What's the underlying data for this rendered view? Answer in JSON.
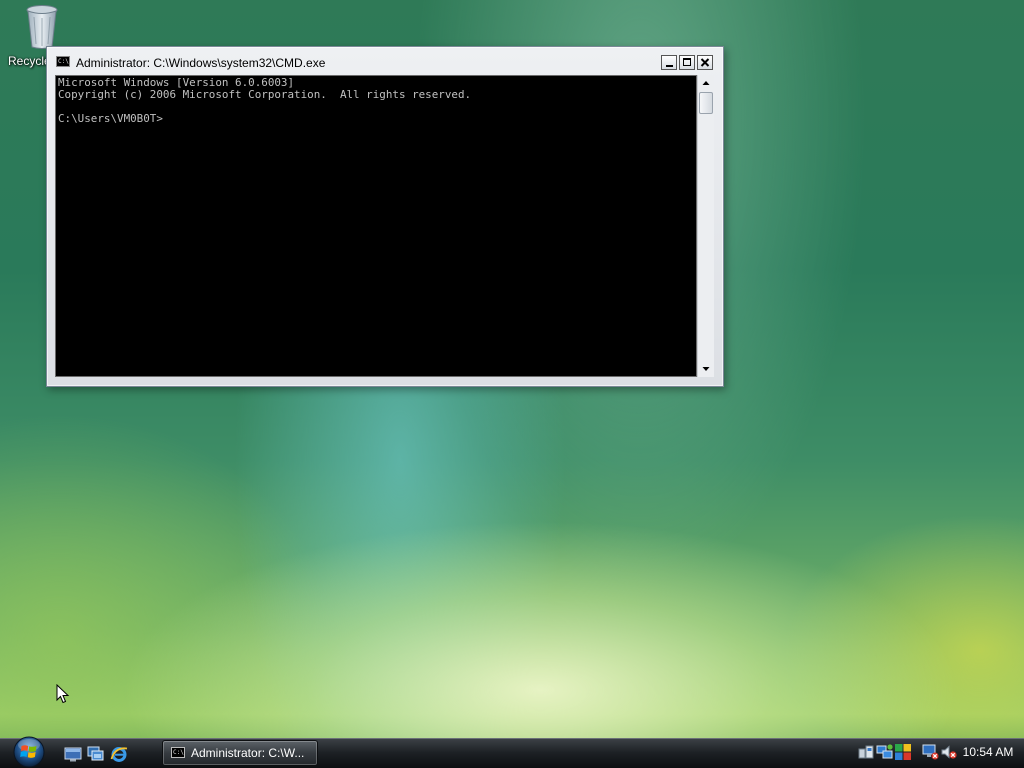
{
  "desktop": {
    "recycle_bin_label": "Recycle"
  },
  "window": {
    "title": "Administrator: C:\\Windows\\system32\\CMD.exe",
    "app_icon_text": "C:\\",
    "console_text": "Microsoft Windows [Version 6.0.6003]\nCopyright (c) 2006 Microsoft Corporation.  All rights reserved.\n\nC:\\Users\\VM0B0T>",
    "background_color": "#000000",
    "text_color": "#c0c0c0"
  },
  "taskbar": {
    "quick_launch": [
      "show-desktop-icon",
      "switch-windows-icon",
      "internet-explorer-icon"
    ],
    "task_button_label": "Administrator: C:\\W...",
    "task_button_icon_text": "C:\\",
    "tray_icons": [
      "network-icon",
      "network-activity-icon",
      "security-center-icon",
      "connection-status-icon",
      "volume-muted-icon"
    ],
    "clock": "10:54 AM"
  }
}
